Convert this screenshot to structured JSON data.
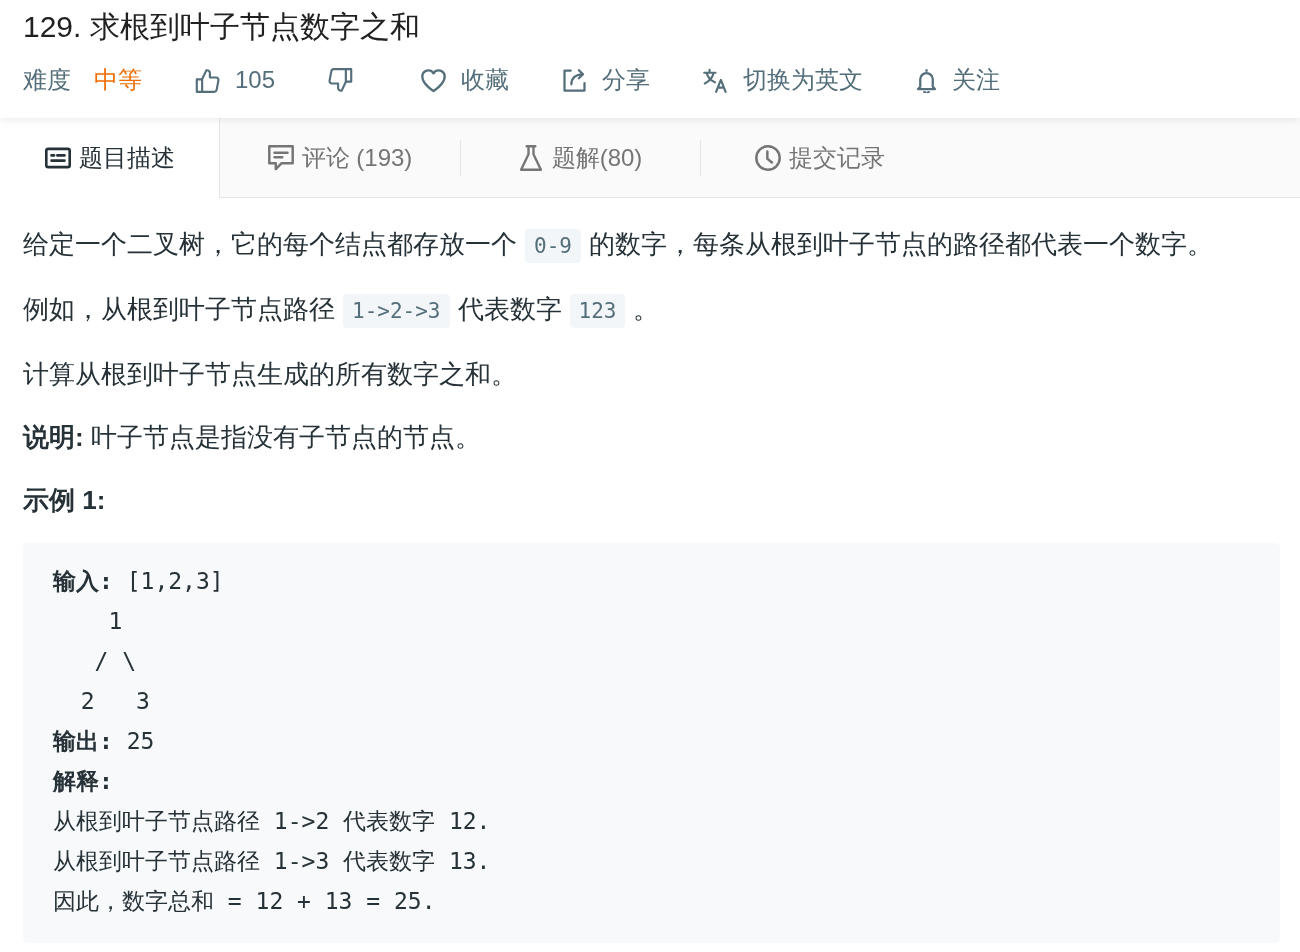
{
  "problem": {
    "title": "129. 求根到叶子节点数字之和"
  },
  "meta": {
    "difficulty_label": "难度",
    "difficulty": "中等"
  },
  "actions": [
    {
      "kind": "like",
      "label": "105"
    },
    {
      "kind": "dislike"
    },
    {
      "kind": "favorite",
      "label": "收藏"
    },
    {
      "kind": "share",
      "label": "分享"
    },
    {
      "kind": "translate",
      "label": "切换为英文"
    },
    {
      "kind": "follow",
      "label": "关注"
    }
  ],
  "tabs": [
    {
      "kind": "description",
      "label": "题目描述",
      "selected": true
    },
    {
      "kind": "comments",
      "label": "评论 (193)",
      "selected": false
    },
    {
      "kind": "solutions",
      "label": "题解(80)",
      "selected": false
    },
    {
      "kind": "submissions",
      "label": "提交记录",
      "selected": false
    }
  ],
  "description": {
    "paragraphs": [
      {
        "parts": [
          {
            "kind": "text",
            "text": "给定一个二叉树，它的每个结点都存放一个"
          },
          {
            "kind": "code",
            "text": "0-9"
          },
          {
            "kind": "text",
            "text": "的数字，每条从根到叶子节点的路径都代表一个数字。"
          }
        ]
      },
      {
        "parts": [
          {
            "kind": "text",
            "text": "例如，从根到叶子节点路径"
          },
          {
            "kind": "code",
            "text": "1->2->3"
          },
          {
            "kind": "text",
            "text": "代表数字"
          },
          {
            "kind": "code",
            "text": "123"
          },
          {
            "kind": "text",
            "text": "。"
          }
        ]
      },
      {
        "parts": [
          {
            "kind": "text",
            "text": "计算从根到叶子节点生成的所有数字之和。"
          }
        ]
      },
      {
        "parts": [
          {
            "kind": "text",
            "text": "**说明:** 叶子节点是指没有子节点的节点。"
          }
        ]
      }
    ],
    "example": {
      "title": "示例 1:",
      "lines": [
        "**输入:** [1,2,3]",
        "    1",
        "   / \\",
        "  2   3",
        "**输出:** 25",
        "**解释:**",
        "从根到叶子节点路径 1->2 代表数字 12.",
        "从根到叶子节点路径 1->3 代表数字 13.",
        "因此，数字总和 = 12 + 13 = 25."
      ]
    }
  }
}
